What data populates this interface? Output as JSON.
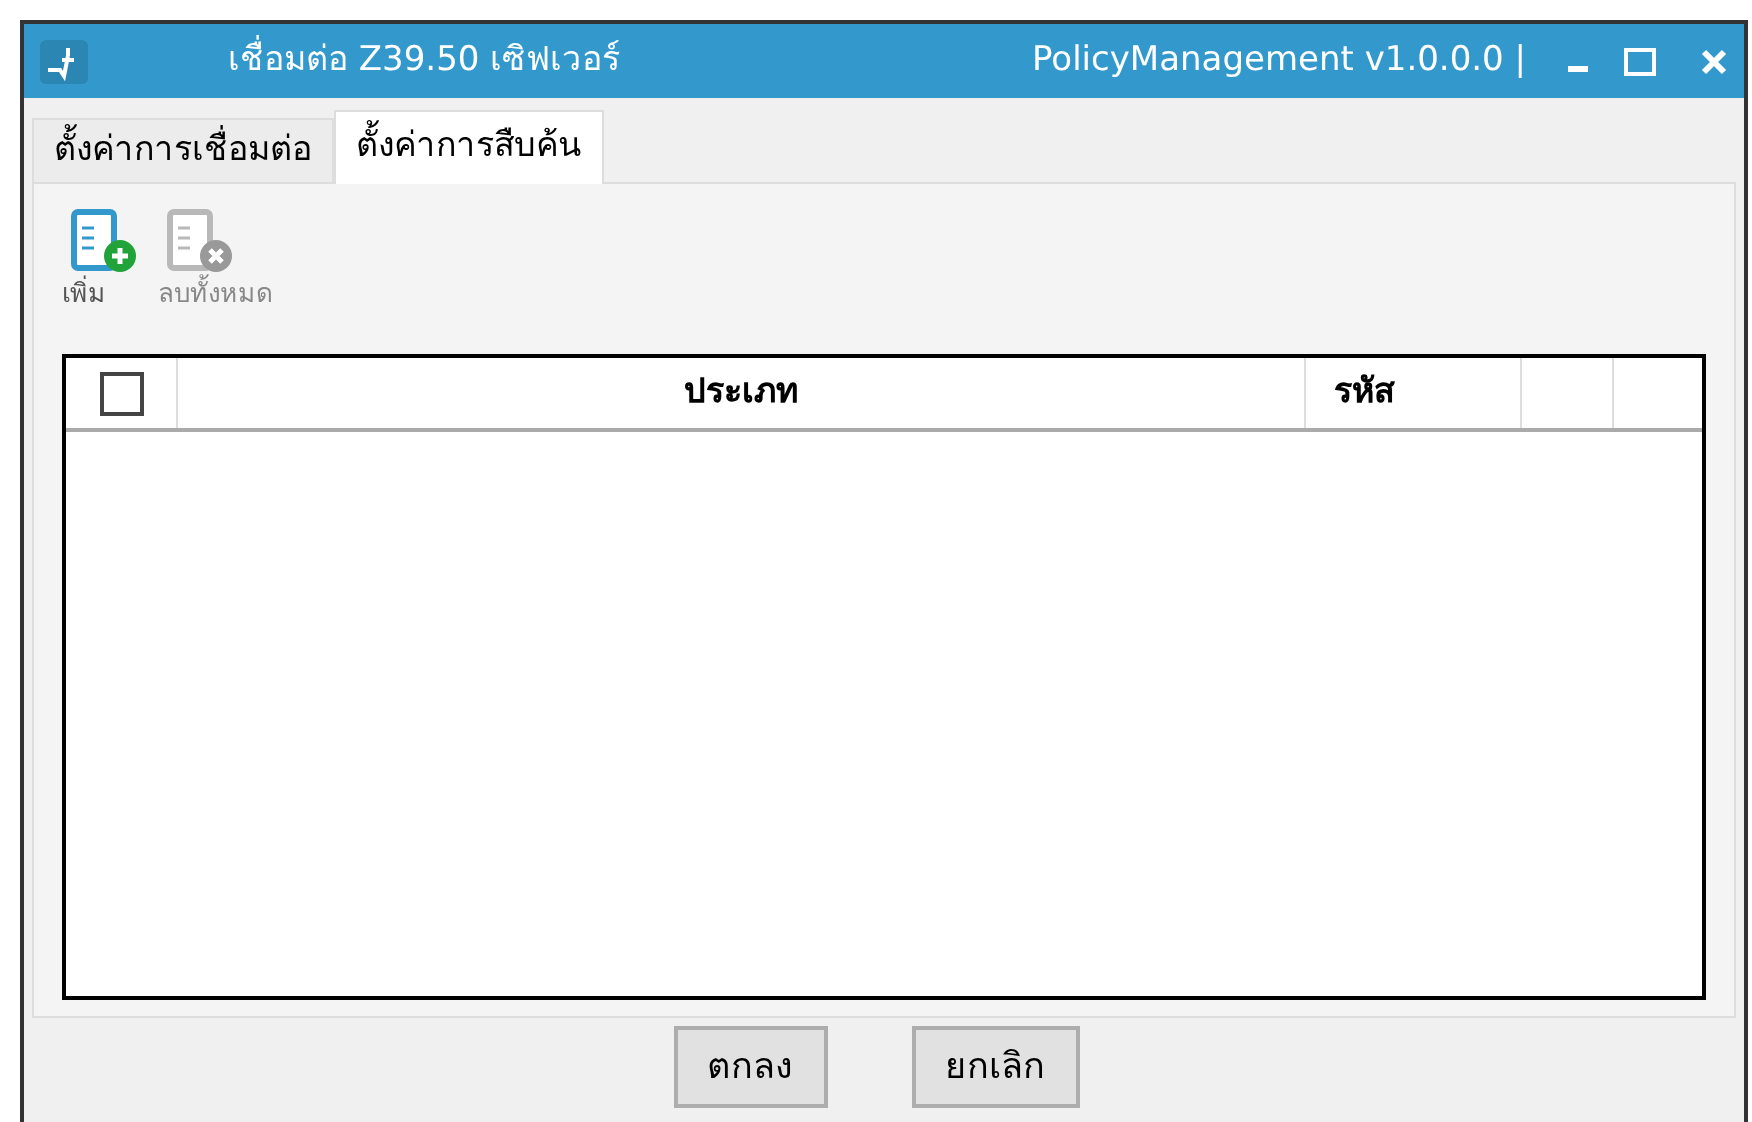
{
  "window": {
    "title": "เชื่อมต่อ Z39.50 เซิฟเวอร์",
    "app_label": "PolicyManagement v1.0.0.0 |"
  },
  "tabs": [
    {
      "label": "ตั้งค่าการเชื่อมต่อ",
      "selected": false
    },
    {
      "label": "ตั้งค่าการสืบค้น",
      "selected": true
    }
  ],
  "toolbar": [
    {
      "kind": "add",
      "label": "เพิ่ม",
      "disabled": false
    },
    {
      "kind": "delete",
      "label": "ลบทั้งหมด",
      "disabled": true
    }
  ],
  "table": {
    "select_all_checked": false,
    "columns": [
      "ประเภท",
      "รหัส"
    ]
  },
  "buttons": [
    "ตกลง",
    "ยกเลิก"
  ]
}
